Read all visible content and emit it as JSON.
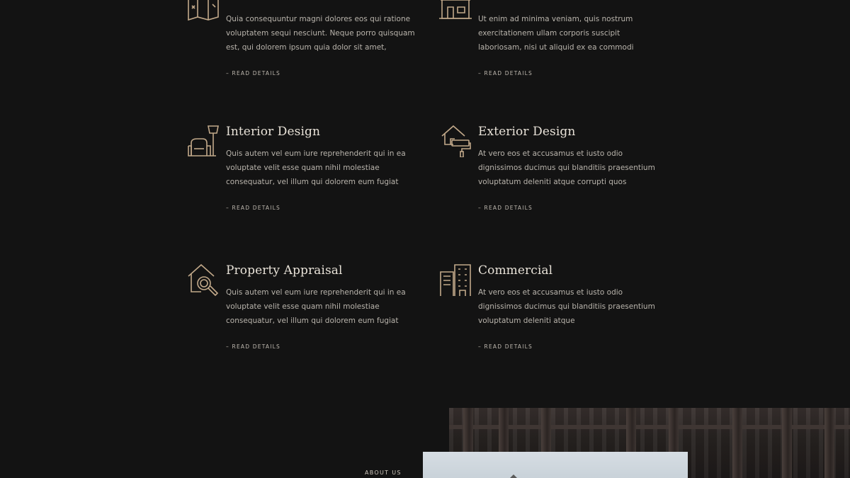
{
  "services": [
    {
      "id": "architecture",
      "icon": "map-icon",
      "title": "",
      "desc": [
        "Quia consequuntur magni dolores eos qui ratione",
        "voluptatem sequi nesciunt. Neque porro quisquam",
        "est, qui dolorem ipsum quia dolor sit amet,"
      ],
      "read_more": "– READ DETAILS"
    },
    {
      "id": "renovation",
      "icon": "house-front-icon",
      "title": "",
      "desc": [
        "Ut enim ad minima veniam, quis nostrum",
        "exercitationem ullam corporis suscipit",
        "laboriosam, nisi ut aliquid ex ea commodi"
      ],
      "read_more": "– READ DETAILS"
    },
    {
      "id": "interior-design",
      "icon": "armchair-lamp-icon",
      "title": "Interior Design",
      "desc": [
        "Quis autem vel eum iure reprehenderit qui in ea",
        "voluptate velit esse quam nihil molestiae",
        "consequatur, vel illum qui dolorem eum fugiat"
      ],
      "read_more": "– READ DETAILS"
    },
    {
      "id": "exterior-design",
      "icon": "house-paint-roller-icon",
      "title": "Exterior Design",
      "desc": [
        "At vero eos et accusamus et iusto odio",
        "dignissimos ducimus qui blanditiis praesentium",
        "voluptatum deleniti atque corrupti quos"
      ],
      "read_more": "– READ DETAILS"
    },
    {
      "id": "property-appraisal",
      "icon": "house-magnifier-icon",
      "title": "Property Appraisal",
      "desc": [
        "Quis autem vel eum iure reprehenderit qui in ea",
        "voluptate velit esse quam nihil molestiae",
        "consequatur, vel illum qui dolorem eum fugiat"
      ],
      "read_more": "– READ DETAILS"
    },
    {
      "id": "commercial",
      "icon": "office-buildings-icon",
      "title": "Commercial",
      "desc": [
        "At vero eos et accusamus et iusto odio",
        "dignissimos ducimus qui blanditiis praesentium",
        "voluptatum deleniti atque"
      ],
      "read_more": "– READ DETAILS"
    }
  ],
  "about": {
    "label": "ABOUT US"
  },
  "colors": {
    "background": "#131313",
    "accent_icon": "#c2a98a",
    "heading": "#e8e2d8",
    "body_text": "#b9b4ac"
  }
}
